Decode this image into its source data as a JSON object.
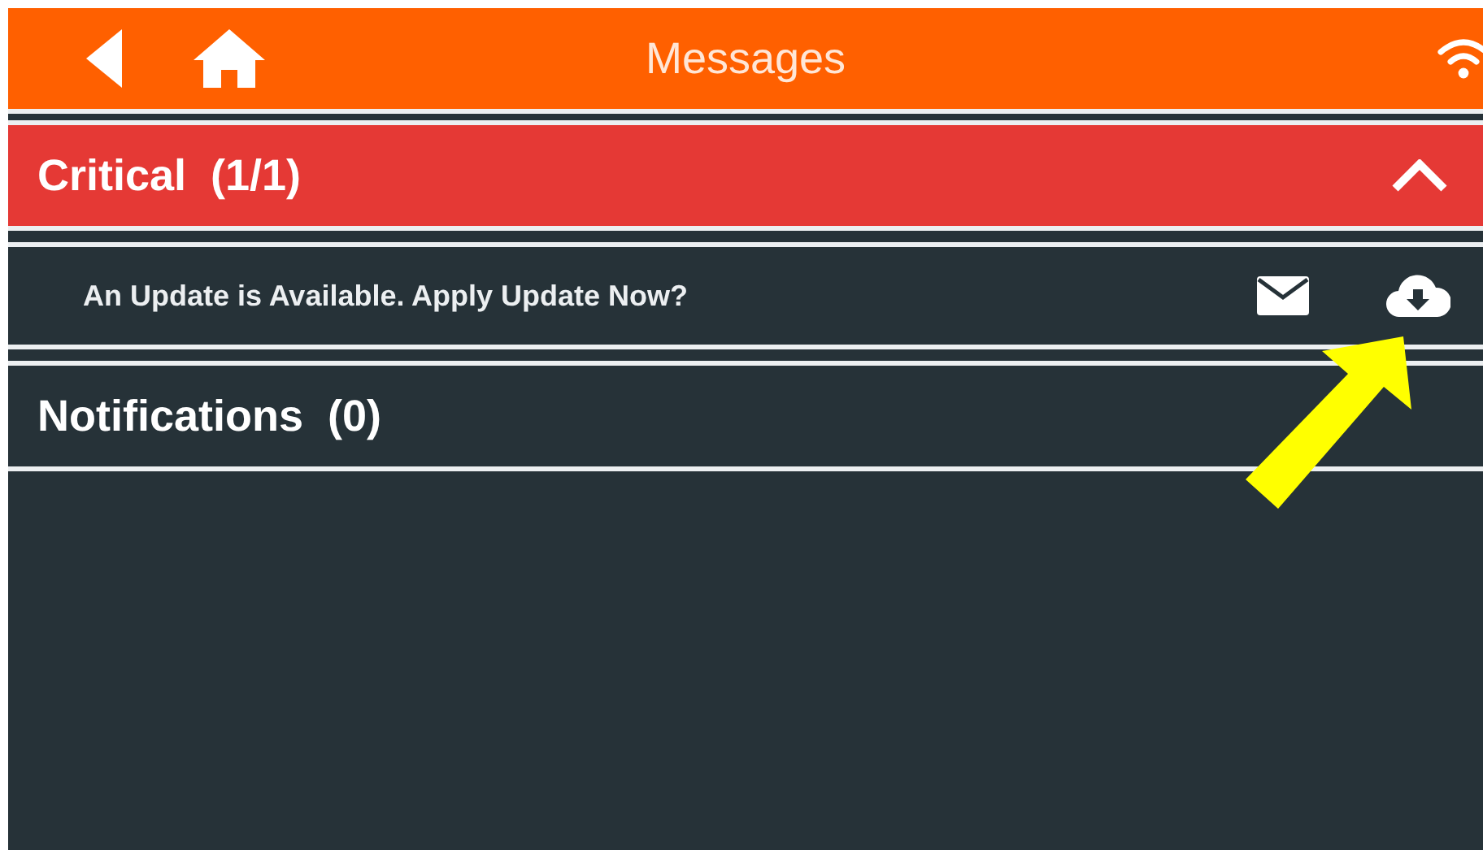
{
  "header": {
    "title": "Messages"
  },
  "sections": [
    {
      "title": "Critical  (1/1)",
      "kind": "critical",
      "expanded": true,
      "items": [
        {
          "text": "An Update is Available. Apply Update Now?"
        }
      ]
    },
    {
      "title": "Notifications  (0)",
      "kind": "normal",
      "expanded": false
    }
  ]
}
